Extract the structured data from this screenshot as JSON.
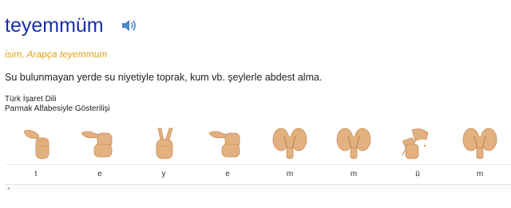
{
  "entry": {
    "word": "teyemmüm",
    "meta": "isim, Arapça teyemmum",
    "definition": "Su bulunmayan yerde su niyetiyle toprak, kum vb. şeylerle abdest alma."
  },
  "sign_section": {
    "line1": "Türk İşaret Dili",
    "line2": "Parmak Alfabesiyle Gösterilişi"
  },
  "letters": [
    "t",
    "e",
    "y",
    "e",
    "m",
    "m",
    "ü",
    "m"
  ],
  "icons": {
    "speaker": "speaker-icon",
    "scroll_left": "scroll-left-arrow-icon"
  },
  "colors": {
    "title": "#1a2fa8",
    "meta": "#e0a21a",
    "skin": "#e3b07f",
    "skin_shadow": "#c88f5c",
    "speaker": "#4a86c8"
  }
}
